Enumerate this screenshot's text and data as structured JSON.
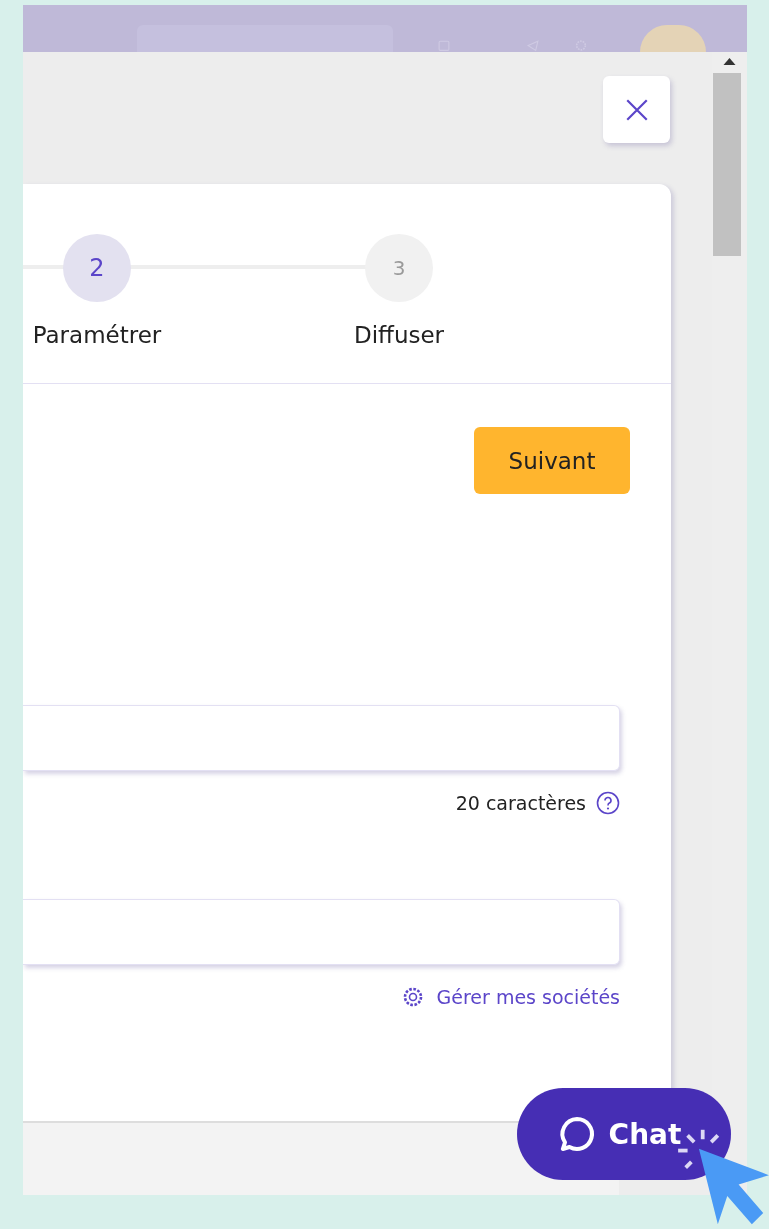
{
  "steps": [
    {
      "number": "2",
      "label": "Paramétrer",
      "selected": true
    },
    {
      "number": "3",
      "label": "Diffuser",
      "selected": false
    }
  ],
  "next_button": "Suivant",
  "fields": [
    {
      "helper": "20 caractères",
      "kind": "help"
    },
    {
      "helper": "Gérer mes sociétés",
      "kind": "link"
    }
  ],
  "chat_button": "Chat"
}
